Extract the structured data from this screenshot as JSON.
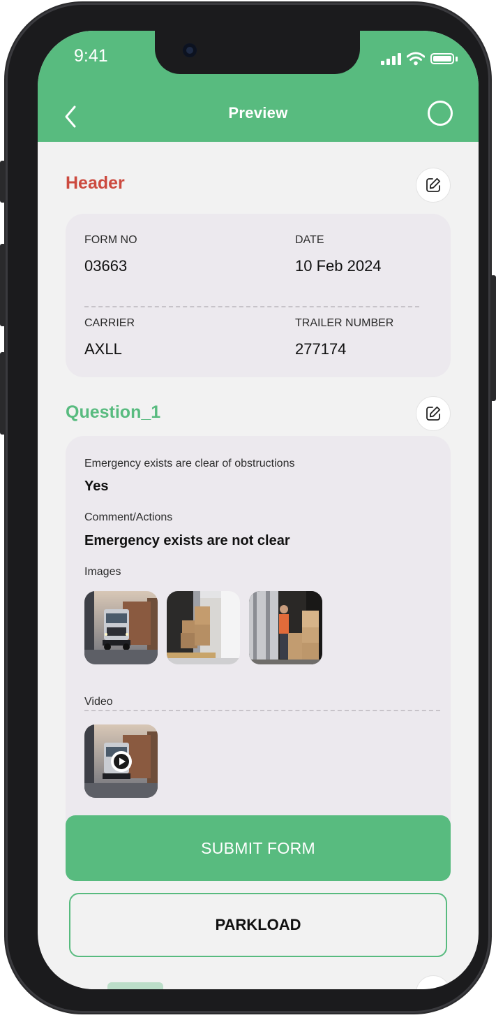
{
  "status_bar": {
    "time": "9:41"
  },
  "appbar": {
    "title": "Preview"
  },
  "header_section": {
    "title": "Header",
    "title_color": "#cc4a3f",
    "fields": [
      {
        "label": "FORM NO",
        "value": "03663"
      },
      {
        "label": "DATE",
        "value": "10 Feb 2024"
      },
      {
        "label": "CARRIER",
        "value": "AXLL"
      },
      {
        "label": "TRAILER NUMBER",
        "value": "277174"
      }
    ]
  },
  "question_section": {
    "title": "Question_1",
    "title_color": "#58bb7f",
    "question": "Emergency exists are clear of obstructions",
    "answer": "Yes",
    "comment_label": "Comment/Actions",
    "comment": "Emergency exists are not clear",
    "images_label": "Images",
    "images": [
      "truck-photo",
      "warehouse-door-photo",
      "worker-boxes-photo"
    ],
    "video_label": "Video",
    "videos": [
      "truck-video"
    ]
  },
  "buttons": {
    "submit": "SUBMIT FORM",
    "parkload": "PARKLOAD"
  },
  "colors": {
    "accent": "#58bb7f",
    "card_bg": "#ece9ee",
    "screen_bg": "#f2f2f2"
  }
}
